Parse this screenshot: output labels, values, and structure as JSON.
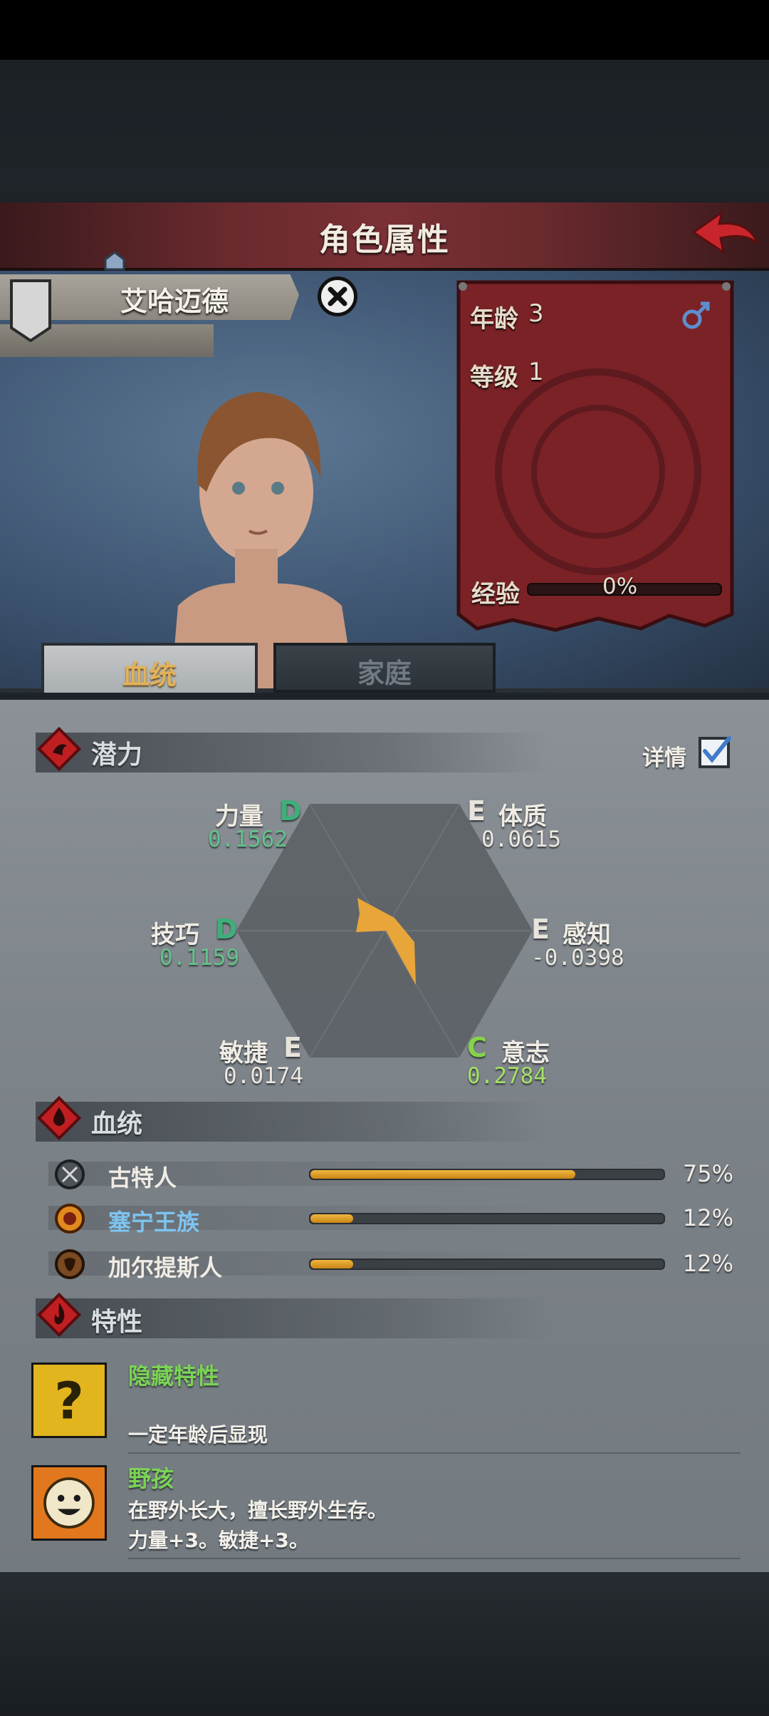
{
  "header": {
    "title": "角色属性",
    "back_icon": "back-arrow-icon"
  },
  "character": {
    "name": "艾哈迈德",
    "age_label": "年龄",
    "age_value": "3",
    "gender_icon": "male-icon",
    "level_label": "等级",
    "level_value": "1",
    "xp_label": "经验",
    "xp_value": "0%",
    "xp_fraction": 0
  },
  "tabs": [
    {
      "label": "血统",
      "active": true
    },
    {
      "label": "家庭",
      "active": false
    }
  ],
  "potential": {
    "title": "潜力",
    "details_label": "详情",
    "details_checked": true,
    "stats": [
      {
        "name": "力量",
        "grade": "D",
        "value": "0.1562",
        "grade_color": "#3fae7a",
        "value_color": "#64c28a"
      },
      {
        "name": "体质",
        "grade": "E",
        "value": "0.0615",
        "grade_color": "#e8e4dc",
        "value_color": "#ece8e0"
      },
      {
        "name": "技巧",
        "grade": "D",
        "value": "0.1159",
        "grade_color": "#3fae7a",
        "value_color": "#64c28a"
      },
      {
        "name": "感知",
        "grade": "E",
        "value": "-0.0398",
        "grade_color": "#e8e4dc",
        "value_color": "#ece8e0"
      },
      {
        "name": "敏捷",
        "grade": "E",
        "value": "0.0174",
        "grade_color": "#e8e4dc",
        "value_color": "#ece8e0"
      },
      {
        "name": "意志",
        "grade": "C",
        "value": "0.2784",
        "grade_color": "#86d34a",
        "value_color": "#a6e068"
      }
    ]
  },
  "bloodline": {
    "title": "血统",
    "items": [
      {
        "name": "古特人",
        "percent": "75%",
        "fraction": 0.75,
        "name_color": "#f0ece4",
        "icon": "crossed-axes-icon"
      },
      {
        "name": "塞宁王族",
        "percent": "12%",
        "fraction": 0.12,
        "name_color": "#7ec4f0",
        "icon": "sun-crest-icon"
      },
      {
        "name": "加尔提斯人",
        "percent": "12%",
        "fraction": 0.12,
        "name_color": "#f0ece4",
        "icon": "ram-head-icon"
      }
    ]
  },
  "traits": {
    "title": "特性",
    "items": [
      {
        "name": "隐藏特性",
        "desc1": "",
        "desc2": "一定年龄后显现",
        "icon": "question-mark-icon"
      },
      {
        "name": "野孩",
        "desc1": "在野外长大，擅长野外生存。",
        "desc2": "力量+3。敏捷+3。",
        "icon": "smiling-face-icon"
      }
    ]
  }
}
